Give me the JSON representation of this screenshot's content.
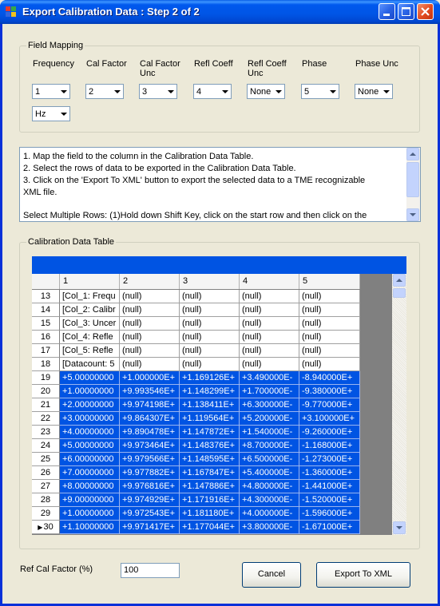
{
  "window": {
    "title": "Export Calibration Data : Step 2 of 2"
  },
  "field_mapping": {
    "label": "Field Mapping",
    "fields": [
      {
        "label_lines": [
          "Frequency",
          ""
        ],
        "value": "1"
      },
      {
        "label_lines": [
          "Cal Factor",
          ""
        ],
        "value": "2"
      },
      {
        "label_lines": [
          "Cal Factor",
          "Unc"
        ],
        "value": "3"
      },
      {
        "label_lines": [
          "Refl Coeff",
          ""
        ],
        "value": "4"
      },
      {
        "label_lines": [
          "Refl Coeff",
          "Unc"
        ],
        "value": "None"
      },
      {
        "label_lines": [
          "Phase",
          ""
        ],
        "value": "5"
      },
      {
        "label_lines": [
          "Phase Unc",
          ""
        ],
        "value": "None"
      }
    ],
    "unit_value": "Hz"
  },
  "instructions": {
    "lines": [
      "1. Map the field to the column in the Calibration Data Table.",
      "2. Select the rows of data to be exported in the Calibration Data Table.",
      "3. Click on the 'Export To XML' button to export the selected data to a TME recognizable",
      "XML file.",
      "",
      "Select Multiple Rows: (1)Hold down Shift Key, click on the start row and then click on the"
    ]
  },
  "table": {
    "label": "Calibration Data Table",
    "columns": [
      "1",
      "2",
      "3",
      "4",
      "5"
    ],
    "rows": [
      {
        "num": "13",
        "current": false,
        "selected": false,
        "cells": [
          "[Col_1: Frequ",
          "(null)",
          "(null)",
          "(null)",
          "(null)"
        ]
      },
      {
        "num": "14",
        "current": false,
        "selected": false,
        "cells": [
          "[Col_2: Calibr",
          "(null)",
          "(null)",
          "(null)",
          "(null)"
        ]
      },
      {
        "num": "15",
        "current": false,
        "selected": false,
        "cells": [
          "[Col_3: Uncer",
          "(null)",
          "(null)",
          "(null)",
          "(null)"
        ]
      },
      {
        "num": "16",
        "current": false,
        "selected": false,
        "cells": [
          "[Col_4: Refle",
          "(null)",
          "(null)",
          "(null)",
          "(null)"
        ]
      },
      {
        "num": "17",
        "current": false,
        "selected": false,
        "cells": [
          "[Col_5: Refle",
          "(null)",
          "(null)",
          "(null)",
          "(null)"
        ]
      },
      {
        "num": "18",
        "current": false,
        "selected": false,
        "cells": [
          "[Datacount: 5",
          "(null)",
          "(null)",
          "(null)",
          "(null)"
        ]
      },
      {
        "num": "19",
        "current": false,
        "selected": true,
        "cells": [
          "+5.00000000",
          "+1.000000E+",
          "+1.169126E+",
          "+3.490000E-",
          "-8.940000E+"
        ]
      },
      {
        "num": "20",
        "current": false,
        "selected": true,
        "cells": [
          "+1.00000000",
          "+9.993546E+",
          "+1.148299E+",
          "+1.700000E-",
          "-9.380000E+"
        ]
      },
      {
        "num": "21",
        "current": false,
        "selected": true,
        "cells": [
          "+2.00000000",
          "+9.974198E+",
          "+1.138411E+",
          "+6.300000E-",
          "-9.770000E+"
        ]
      },
      {
        "num": "22",
        "current": false,
        "selected": true,
        "cells": [
          "+3.00000000",
          "+9.864307E+",
          "+1.119564E+",
          "+5.200000E-",
          "+3.100000E+"
        ]
      },
      {
        "num": "23",
        "current": false,
        "selected": true,
        "cells": [
          "+4.00000000",
          "+9.890478E+",
          "+1.147872E+",
          "+1.540000E-",
          "-9.260000E+"
        ]
      },
      {
        "num": "24",
        "current": false,
        "selected": true,
        "cells": [
          "+5.00000000",
          "+9.973464E+",
          "+1.148376E+",
          "+8.700000E-",
          "-1.168000E+"
        ]
      },
      {
        "num": "25",
        "current": false,
        "selected": true,
        "cells": [
          "+6.00000000",
          "+9.979566E+",
          "+1.148595E+",
          "+6.500000E-",
          "-1.273000E+"
        ]
      },
      {
        "num": "26",
        "current": false,
        "selected": true,
        "cells": [
          "+7.00000000",
          "+9.977882E+",
          "+1.167847E+",
          "+5.400000E-",
          "-1.360000E+"
        ]
      },
      {
        "num": "27",
        "current": false,
        "selected": true,
        "cells": [
          "+8.00000000",
          "+9.976816E+",
          "+1.147886E+",
          "+4.800000E-",
          "-1.441000E+"
        ]
      },
      {
        "num": "28",
        "current": false,
        "selected": true,
        "cells": [
          "+9.00000000",
          "+9.974929E+",
          "+1.171916E+",
          "+4.300000E-",
          "-1.520000E+"
        ]
      },
      {
        "num": "29",
        "current": false,
        "selected": true,
        "cells": [
          "+1.00000000",
          "+9.972543E+",
          "+1.181180E+",
          "+4.000000E-",
          "-1.596000E+"
        ]
      },
      {
        "num": "30",
        "current": true,
        "selected": true,
        "cells": [
          "+1.10000000",
          "+9.971417E+",
          "+1.177044E+",
          "+3.800000E-",
          "-1.671000E+"
        ]
      }
    ]
  },
  "ref_cal_factor": {
    "label": "Ref Cal Factor (%)",
    "value": "100"
  },
  "buttons": {
    "cancel": "Cancel",
    "export": "Export To XML"
  },
  "colors": {
    "title_bar": "#0054e3",
    "selection": "#0054e3",
    "window_bg": "#ece9d8"
  },
  "icons": {
    "app": "app-icon",
    "current_row": "current-row-arrow-icon"
  }
}
